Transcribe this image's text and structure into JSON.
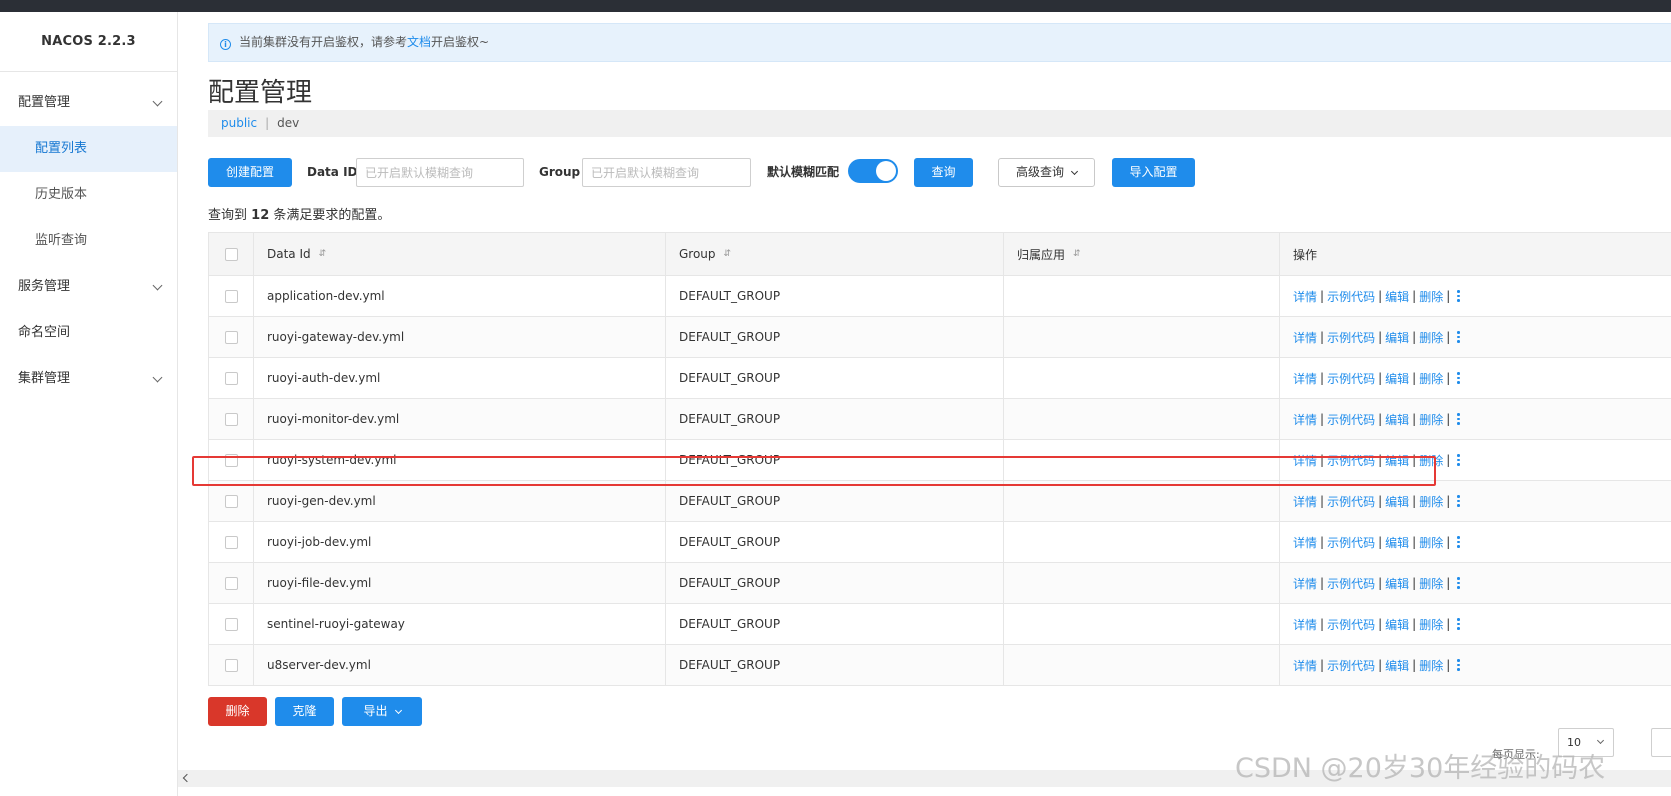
{
  "app": {
    "brand": "NACOS 2.2.3"
  },
  "sidebar": {
    "groups": [
      {
        "label": "配置管理",
        "children": [
          "配置列表",
          "历史版本",
          "监听查询"
        ]
      },
      {
        "label": "服务管理"
      },
      {
        "label": "命名空间"
      },
      {
        "label": "集群管理"
      }
    ],
    "active_item": "配置列表"
  },
  "alert": {
    "text_before": "当前集群没有开启鉴权，请参考",
    "link": "文档",
    "text_after": "开启鉴权~",
    "icon": "info-icon"
  },
  "page_title": "配置管理",
  "namespaces": {
    "active": "public",
    "separator": "|",
    "other": "dev"
  },
  "toolbar": {
    "create_label": "创建配置",
    "data_id_label": "Data ID",
    "data_id_placeholder": "已开启默认模糊查询",
    "group_label": "Group",
    "group_placeholder": "已开启默认模糊查询",
    "fuzzy_label": "默认模糊匹配",
    "fuzzy_enabled": true,
    "query_label": "查询",
    "advanced_label": "高级查询",
    "import_label": "导入配置"
  },
  "summary": {
    "prefix": "查询到",
    "count": "12",
    "suffix": "条满足要求的配置。"
  },
  "table": {
    "columns": [
      "Data Id",
      "Group",
      "归属应用",
      "操作"
    ],
    "actions": [
      "详情",
      "示例代码",
      "编辑",
      "删除"
    ],
    "rows": [
      {
        "data_id": "application-dev.yml",
        "group": "DEFAULT_GROUP",
        "app": ""
      },
      {
        "data_id": "ruoyi-gateway-dev.yml",
        "group": "DEFAULT_GROUP",
        "app": ""
      },
      {
        "data_id": "ruoyi-auth-dev.yml",
        "group": "DEFAULT_GROUP",
        "app": ""
      },
      {
        "data_id": "ruoyi-monitor-dev.yml",
        "group": "DEFAULT_GROUP",
        "app": ""
      },
      {
        "data_id": "ruoyi-system-dev.yml",
        "group": "DEFAULT_GROUP",
        "app": ""
      },
      {
        "data_id": "ruoyi-gen-dev.yml",
        "group": "DEFAULT_GROUP",
        "app": ""
      },
      {
        "data_id": "ruoyi-job-dev.yml",
        "group": "DEFAULT_GROUP",
        "app": ""
      },
      {
        "data_id": "ruoyi-file-dev.yml",
        "group": "DEFAULT_GROUP",
        "app": ""
      },
      {
        "data_id": "sentinel-ruoyi-gateway",
        "group": "DEFAULT_GROUP",
        "app": ""
      },
      {
        "data_id": "u8server-dev.yml",
        "group": "DEFAULT_GROUP",
        "app": ""
      }
    ],
    "highlighted_row": "ruoyi-system-dev.yml"
  },
  "bottom": {
    "delete_label": "删除",
    "clone_label": "克隆",
    "export_label": "导出"
  },
  "pager": {
    "page_size_label": "每页显示:",
    "page_size": "10"
  },
  "watermark": "CSDN @20岁30年经验的码农",
  "colors": {
    "primary": "#1f8ceb",
    "danger": "#d9372a",
    "highlight_border": "#e53935"
  }
}
